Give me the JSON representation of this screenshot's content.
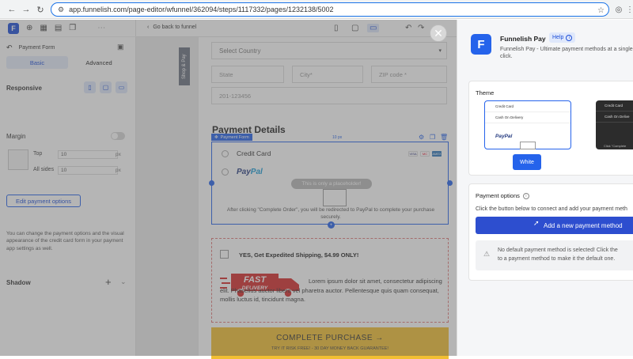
{
  "browser": {
    "url": "app.funnelish.com/page-editor/wfunnel/362094/steps/1117332/pages/1232138/5002"
  },
  "toolbar": {
    "logo": "F",
    "back_to_funnel": "Go back to funnel"
  },
  "sidebar": {
    "title": "Payment Form",
    "tabs": [
      "Basic",
      "Advanced"
    ],
    "responsive_label": "Responsive",
    "margin_label": "Margin",
    "margin_top_label": "Top",
    "margin_top_value": "10",
    "margin_sides_label": "All sides",
    "margin_sides_value": "10",
    "px_unit": "px",
    "edit_button": "Edit payment options",
    "help_text": "You can change the payment options and the visual appearance of the credit card form in your payment app settings as well.",
    "shadow_label": "Shadow"
  },
  "canvas": {
    "strip_text": "Shop & Pay",
    "country_select": "Select Country",
    "state_input": "State",
    "city_input": "City*",
    "zip_input": "ZIP code *",
    "phone_input": "201-123456",
    "payment_heading": "Payment Details",
    "payment_form_tag": "Payment Form",
    "margin_marker": "10 px",
    "credit_card_label": "Credit Card",
    "paypal_pay": "Pay",
    "paypal_pal": "Pal",
    "placeholder_note": "This is only a placeholder!",
    "redirect_text": "After clicking \"Complete Order\", you will be redirected to PayPal to complete your purchase securely.",
    "bump_title": "YES, Get Expedited Shipping, $4.99 ONLY!",
    "bump_badge_line1": "FAST",
    "bump_badge_line2": "DELIVERY",
    "bump_text": "Lorem ipsum dolor sit amet, consectetur adipiscing elit. Phasellus auctor libero vel pharetra auctor. Pellentesque quis quam consequat, mollis luctus id, tincidunt magna.",
    "purchase_label": "COMPLETE PURCHASE →",
    "purchase_sub": "TRY IT RISK FREE! - 30 DAY MONEY BACK GUARANTEE!",
    "card_logos": [
      "VISA",
      "MC",
      "AMEX"
    ]
  },
  "panel": {
    "logo": "F",
    "title": "Funnelish Pay",
    "help": "Help",
    "description": "Funnelish Pay - Ultimate payment methods at a single click.",
    "theme_label": "Theme",
    "theme_rows": [
      "Credit Card",
      "Cash On Delivery"
    ],
    "theme_paypal": "PayPal",
    "theme_dark_rows": [
      "Credit Card",
      "Cash On Delive"
    ],
    "theme_dark_footer": "Click \"Complete",
    "white_button": "White",
    "payment_options_label": "Payment options",
    "payment_options_desc": "Click the button below to connect and add your payment meth",
    "add_payment_button": "Add a new payment method",
    "warning_line1": "No default payment method is selected! Click the",
    "warning_line2": "to a payment method to make it the default one."
  },
  "colors": {
    "accent": "#2563eb",
    "purchase": "#f2bf32",
    "fast_delivery": "#d62b2b"
  }
}
